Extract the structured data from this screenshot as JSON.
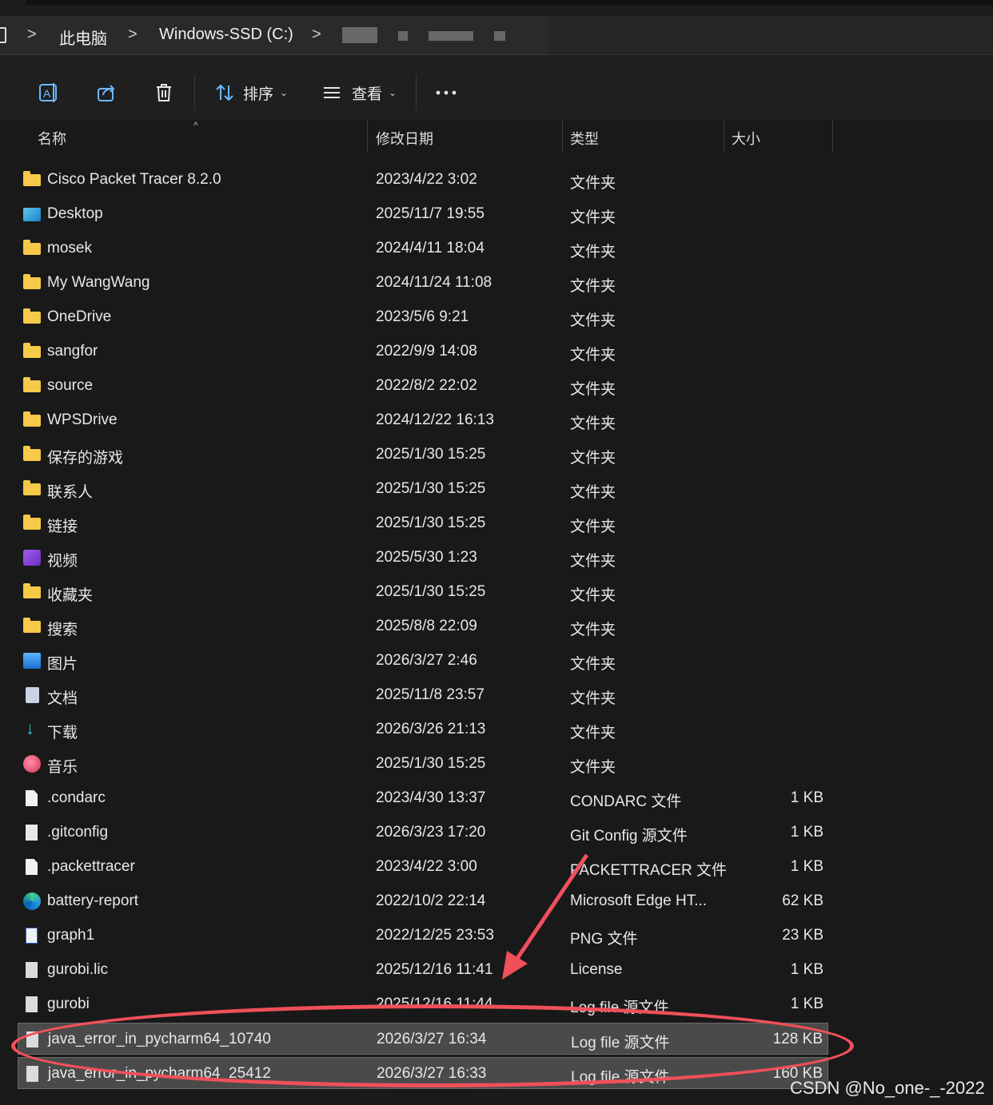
{
  "breadcrumb": {
    "items": [
      "此电脑",
      "Windows-SSD (C:)"
    ],
    "separator": ">"
  },
  "toolbar": {
    "sort_label": "排序",
    "view_label": "查看"
  },
  "columns": {
    "name": "名称",
    "date": "修改日期",
    "type": "类型",
    "size": "大小"
  },
  "files": [
    {
      "name": "Cisco Packet Tracer 8.2.0",
      "date": "2023/4/22 3:02",
      "type": "文件夹",
      "size": "",
      "icon": "folder-icon"
    },
    {
      "name": "Desktop",
      "date": "2025/11/7 19:55",
      "type": "文件夹",
      "size": "",
      "icon": "desktop-folder-icon"
    },
    {
      "name": "mosek",
      "date": "2024/4/11 18:04",
      "type": "文件夹",
      "size": "",
      "icon": "folder-icon"
    },
    {
      "name": "My WangWang",
      "date": "2024/11/24 11:08",
      "type": "文件夹",
      "size": "",
      "icon": "folder-icon"
    },
    {
      "name": "OneDrive",
      "date": "2023/5/6 9:21",
      "type": "文件夹",
      "size": "",
      "icon": "folder-icon"
    },
    {
      "name": "sangfor",
      "date": "2022/9/9 14:08",
      "type": "文件夹",
      "size": "",
      "icon": "folder-icon"
    },
    {
      "name": "source",
      "date": "2022/8/2 22:02",
      "type": "文件夹",
      "size": "",
      "icon": "folder-icon"
    },
    {
      "name": "WPSDrive",
      "date": "2024/12/22 16:13",
      "type": "文件夹",
      "size": "",
      "icon": "folder-icon"
    },
    {
      "name": "保存的游戏",
      "date": "2025/1/30 15:25",
      "type": "文件夹",
      "size": "",
      "icon": "folder-icon"
    },
    {
      "name": "联系人",
      "date": "2025/1/30 15:25",
      "type": "文件夹",
      "size": "",
      "icon": "folder-icon"
    },
    {
      "name": "链接",
      "date": "2025/1/30 15:25",
      "type": "文件夹",
      "size": "",
      "icon": "folder-icon"
    },
    {
      "name": "视频",
      "date": "2025/5/30 1:23",
      "type": "文件夹",
      "size": "",
      "icon": "videos-folder-icon"
    },
    {
      "name": "收藏夹",
      "date": "2025/1/30 15:25",
      "type": "文件夹",
      "size": "",
      "icon": "folder-icon"
    },
    {
      "name": "搜索",
      "date": "2025/8/8 22:09",
      "type": "文件夹",
      "size": "",
      "icon": "folder-icon"
    },
    {
      "name": "图片",
      "date": "2026/3/27 2:46",
      "type": "文件夹",
      "size": "",
      "icon": "pictures-folder-icon"
    },
    {
      "name": "文档",
      "date": "2025/11/8 23:57",
      "type": "文件夹",
      "size": "",
      "icon": "documents-folder-icon"
    },
    {
      "name": "下载",
      "date": "2026/3/26 21:13",
      "type": "文件夹",
      "size": "",
      "icon": "downloads-folder-icon"
    },
    {
      "name": "音乐",
      "date": "2025/1/30 15:25",
      "type": "文件夹",
      "size": "",
      "icon": "music-folder-icon"
    },
    {
      "name": ".condarc",
      "date": "2023/4/30 13:37",
      "type": "CONDARC 文件",
      "size": "1 KB",
      "icon": "file-icon"
    },
    {
      "name": ".gitconfig",
      "date": "2026/3/23 17:20",
      "type": "Git Config 源文件",
      "size": "1 KB",
      "icon": "config-file-icon"
    },
    {
      "name": ".packettracer",
      "date": "2023/4/22 3:00",
      "type": "PACKETTRACER 文件",
      "size": "1 KB",
      "icon": "file-icon"
    },
    {
      "name": "battery-report",
      "date": "2022/10/2 22:14",
      "type": "Microsoft Edge HT...",
      "size": "62 KB",
      "icon": "edge-icon"
    },
    {
      "name": "graph1",
      "date": "2022/12/25 23:53",
      "type": "PNG 文件",
      "size": "23 KB",
      "icon": "image-file-icon"
    },
    {
      "name": "gurobi.lic",
      "date": "2025/12/16 11:41",
      "type": "License",
      "size": "1 KB",
      "icon": "text-file-icon"
    },
    {
      "name": "gurobi",
      "date": "2025/12/16 11:44",
      "type": "Log file 源文件",
      "size": "1 KB",
      "icon": "text-file-icon"
    },
    {
      "name": "java_error_in_pycharm64_10740",
      "date": "2026/3/27 16:34",
      "type": "Log file 源文件",
      "size": "128 KB",
      "icon": "text-file-icon",
      "selected": true
    },
    {
      "name": "java_error_in_pycharm64_25412",
      "date": "2026/3/27 16:33",
      "type": "Log file 源文件",
      "size": "160 KB",
      "icon": "text-file-icon",
      "selected": true
    }
  ],
  "watermark": "CSDN @No_one-_-2022",
  "colors": {
    "background": "#191919",
    "annotation": "#f0505a",
    "folder": "#f7c948"
  }
}
